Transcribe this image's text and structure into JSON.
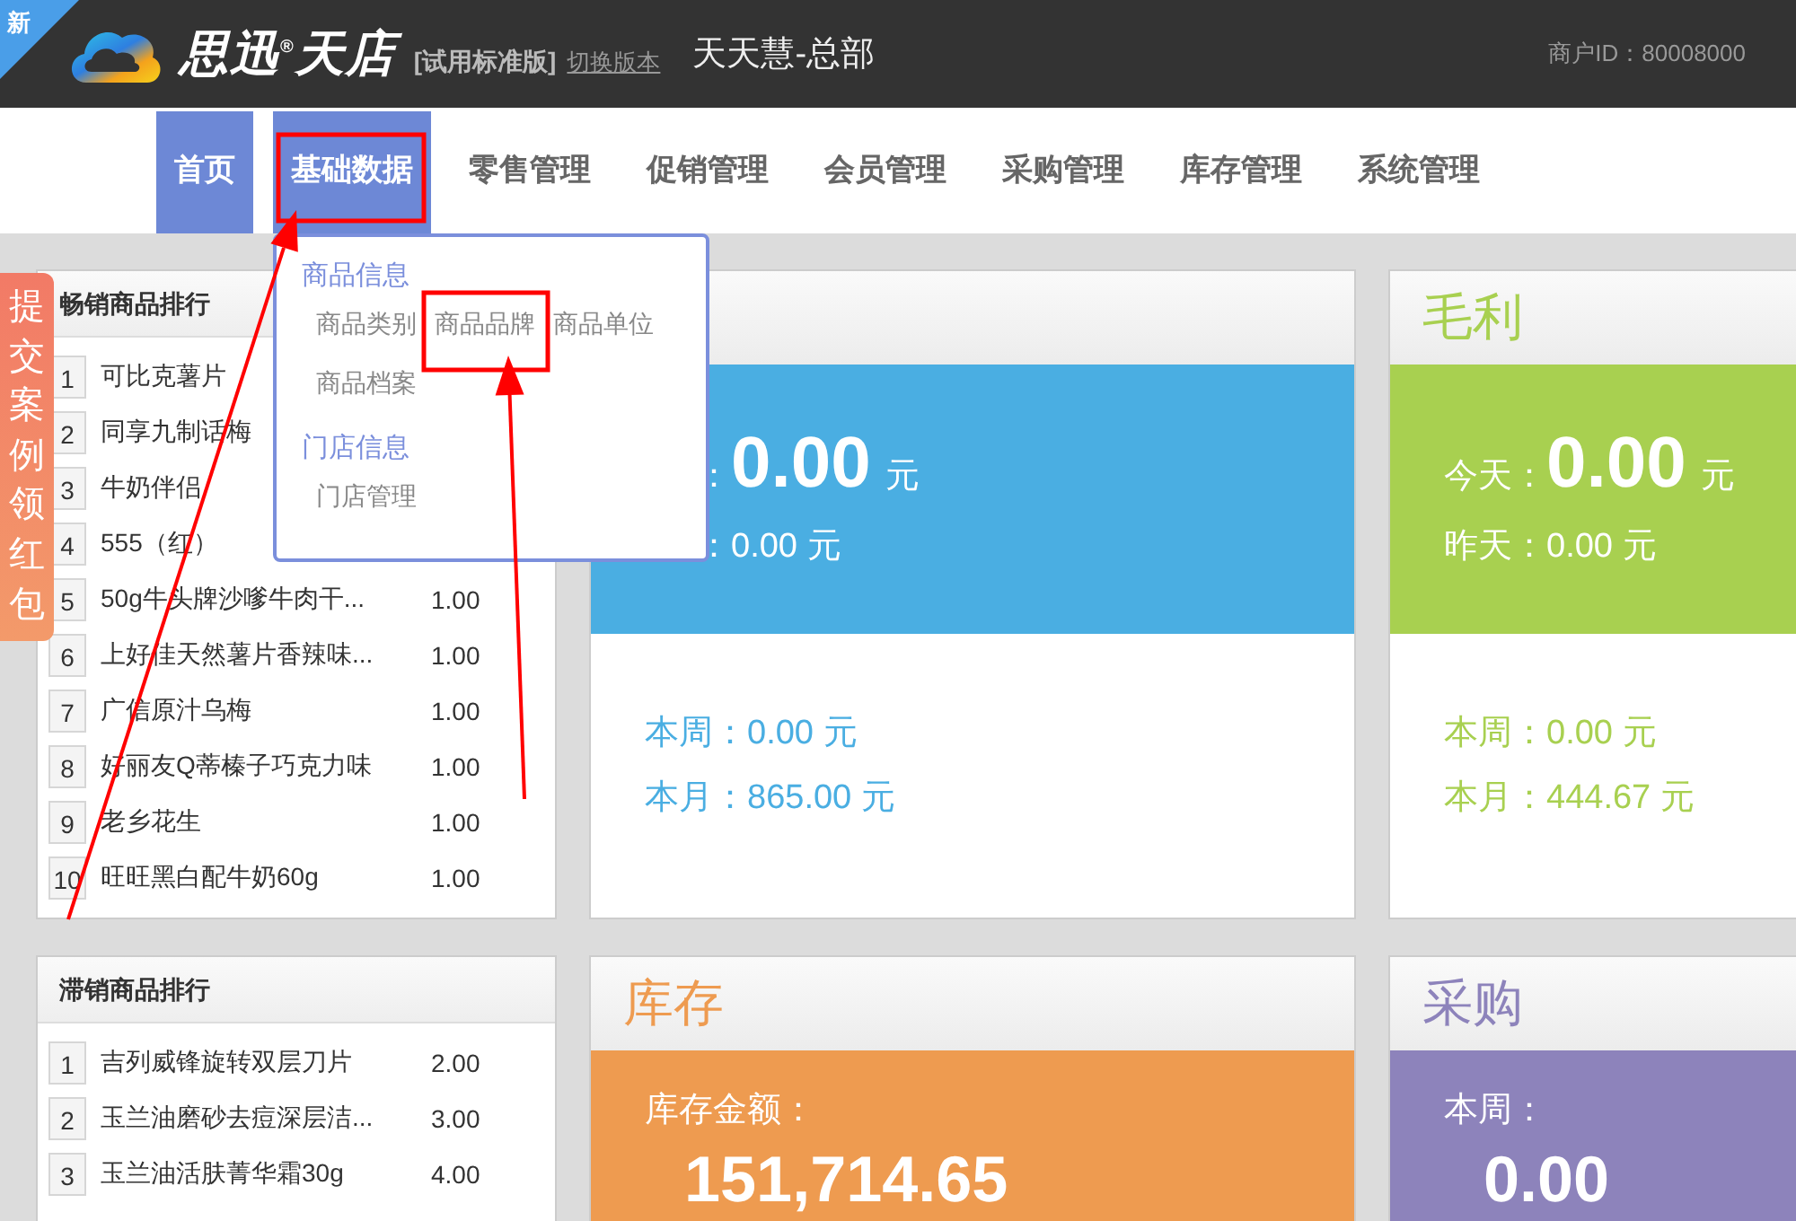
{
  "header": {
    "corner_badge": "新",
    "brand": "思迅$^{®}$天店",
    "edition": "[试用标准版]",
    "switch_link": "切换版本",
    "store": "天天慧-总部",
    "merchant_id": "商户ID：80008000"
  },
  "nav": [
    {
      "label": "首页",
      "selected": true
    },
    {
      "label": "基础数据",
      "selected": true
    },
    {
      "label": "零售管理",
      "selected": false
    },
    {
      "label": "促销管理",
      "selected": false
    },
    {
      "label": "会员管理",
      "selected": false
    },
    {
      "label": "采购管理",
      "selected": false
    },
    {
      "label": "库存管理",
      "selected": false
    },
    {
      "label": "系统管理",
      "selected": false
    }
  ],
  "dropdown": {
    "groups": [
      {
        "title": "商品信息",
        "items": [
          "商品类别",
          "商品品牌",
          "商品单位",
          "商品档案"
        ]
      },
      {
        "title": "门店信息",
        "items": [
          "门店管理"
        ]
      }
    ]
  },
  "side_tab": "提交案例领红包",
  "best_sellers": {
    "title": "畅销商品排行",
    "rows": [
      {
        "rank": "1",
        "name": "可比克薯片"
      },
      {
        "rank": "2",
        "name": "同享九制话梅"
      },
      {
        "rank": "3",
        "name": "牛奶伴侣"
      },
      {
        "rank": "4",
        "name": "555（红）"
      },
      {
        "rank": "5",
        "name": "50g牛头牌沙嗲牛肉干...",
        "value": "1.00"
      },
      {
        "rank": "6",
        "name": "上好佳天然薯片香辣味...",
        "value": "1.00"
      },
      {
        "rank": "7",
        "name": "广信原汁乌梅",
        "value": "1.00"
      },
      {
        "rank": "8",
        "name": "好丽友Q蒂榛子巧克力味",
        "value": "1.00"
      },
      {
        "rank": "9",
        "name": "老乡花生",
        "value": "1.00"
      },
      {
        "rank": "10",
        "name": "旺旺黑白配牛奶60g",
        "value": "1.00"
      }
    ]
  },
  "slow_sellers": {
    "title": "滞销商品排行",
    "rows": [
      {
        "rank": "1",
        "name": "吉列威锋旋转双层刀片",
        "value": "2.00"
      },
      {
        "rank": "2",
        "name": "玉兰油磨砂去痘深层洁...",
        "value": "3.00"
      },
      {
        "rank": "3",
        "name": "玉兰油活肤菁华霜30g",
        "value": "4.00"
      }
    ]
  },
  "top_cards": [
    {
      "kind": "summary",
      "color": "#4aaee2",
      "today_label": "：",
      "today_value": "0.00",
      "unit": "元",
      "yesterday_label": "：",
      "yesterday_value": "0.00 元",
      "week": "本周：0.00 元",
      "month": "本月：865.00 元"
    },
    {
      "kind": "summary",
      "title": "毛利",
      "color": "#a8d050",
      "today_label": "今天：",
      "today_value": "0.00",
      "unit": "元",
      "yesterday_label": "昨天：",
      "yesterday_value": "0.00 元",
      "week": "本周：0.00 元",
      "month": "本月：444.67 元"
    }
  ],
  "bottom_cards": [
    {
      "kind": "amount",
      "title": "库存",
      "color": "#ee9b50",
      "label": "库存金额：",
      "value": "151,714.65"
    },
    {
      "kind": "amount",
      "title": "采购",
      "color": "#8d83bb",
      "label": "本周：",
      "value": "0.00"
    }
  ]
}
